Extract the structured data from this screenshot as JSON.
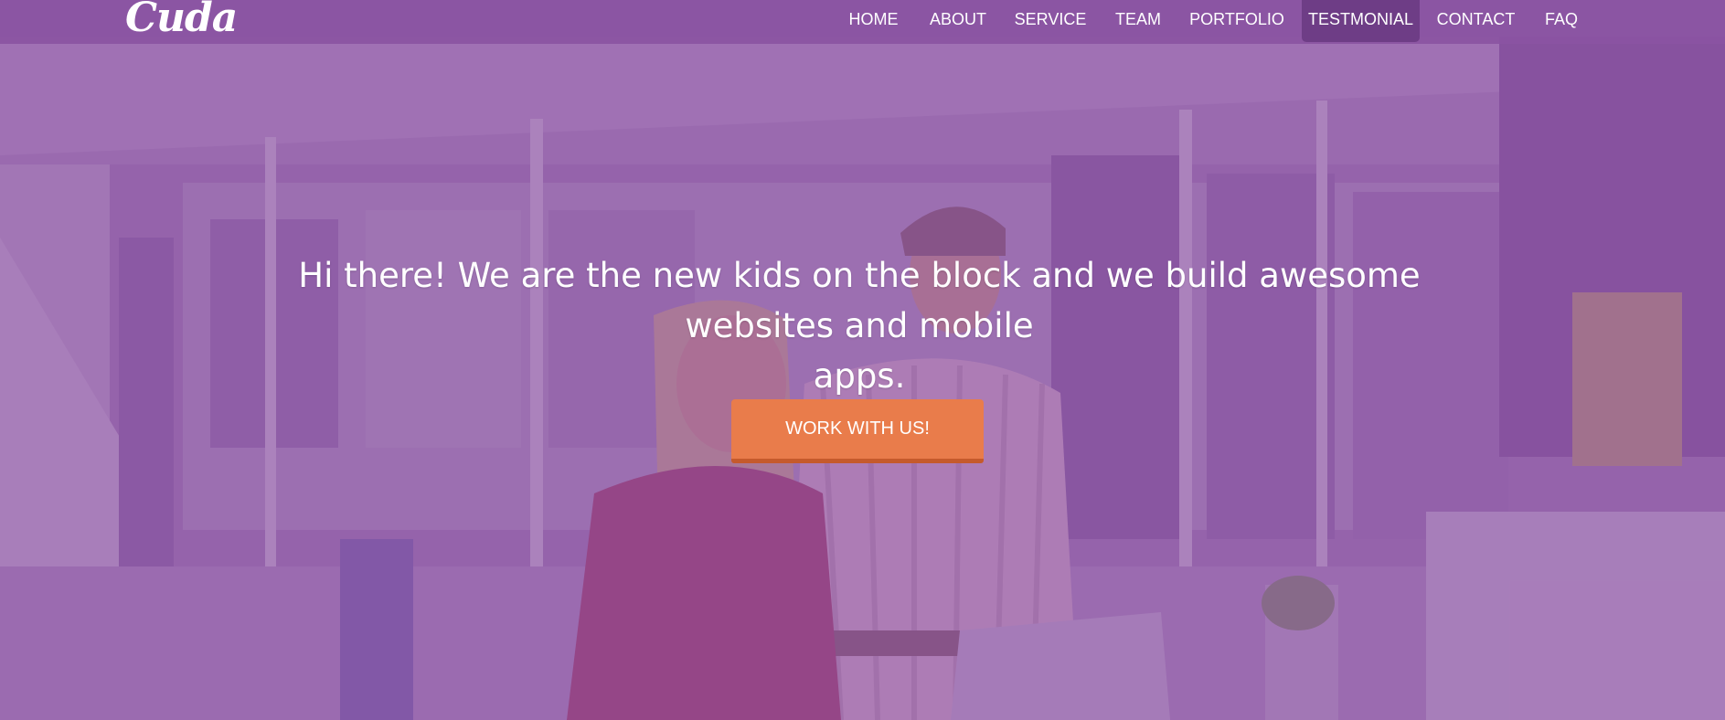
{
  "brand": {
    "logo_text": "Cuda"
  },
  "nav": {
    "items": [
      {
        "label": "HOME"
      },
      {
        "label": "ABOUT"
      },
      {
        "label": "SERVICE"
      },
      {
        "label": "TEAM"
      },
      {
        "label": "PORTFOLIO"
      },
      {
        "label": "TESTMONIAL",
        "active": true
      },
      {
        "label": "CONTACT"
      },
      {
        "label": "FAQ"
      }
    ]
  },
  "hero": {
    "headline_line1": "Hi there! We are the new kids on the block and we build awesome websites and mobile",
    "headline_line2": "apps.",
    "cta_label": "WORK WITH US!"
  },
  "colors": {
    "overlay": "#925ca8",
    "navbar": "#8a54a2",
    "nav_active": "#6e3d86",
    "cta": "#e97c4b",
    "cta_border": "#c55a2c",
    "text": "#ffffff"
  }
}
